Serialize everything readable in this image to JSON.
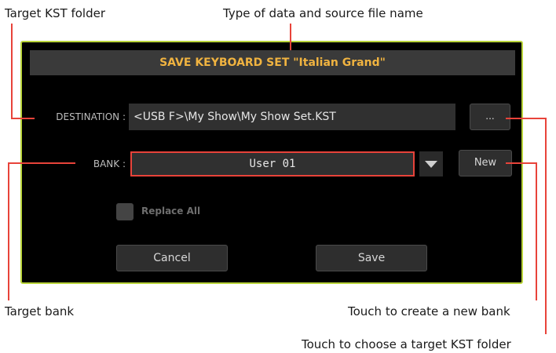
{
  "annotations": {
    "target_folder": "Target KST folder",
    "type_and_source": "Type of data and source file name",
    "target_bank": "Target bank",
    "create_bank": "Touch to create a new bank",
    "choose_folder": "Touch to choose a target KST folder"
  },
  "dialog": {
    "title": "SAVE KEYBOARD SET \"Italian Grand\"",
    "destination_label": "DESTINATION :",
    "destination_value": "<USB F>\\My Show\\My Show Set.KST",
    "browse_button": "...",
    "bank_label": "BANK :",
    "bank_value": "User 01",
    "new_button": "New",
    "replace_all_label": "Replace All",
    "replace_all_checked": false,
    "cancel_button": "Cancel",
    "save_button": "Save"
  },
  "colors": {
    "dialog_border": "#b9d43a",
    "title_text": "#f0b340",
    "callout_line": "#e8433a",
    "bank_field_border": "#e8433a"
  }
}
